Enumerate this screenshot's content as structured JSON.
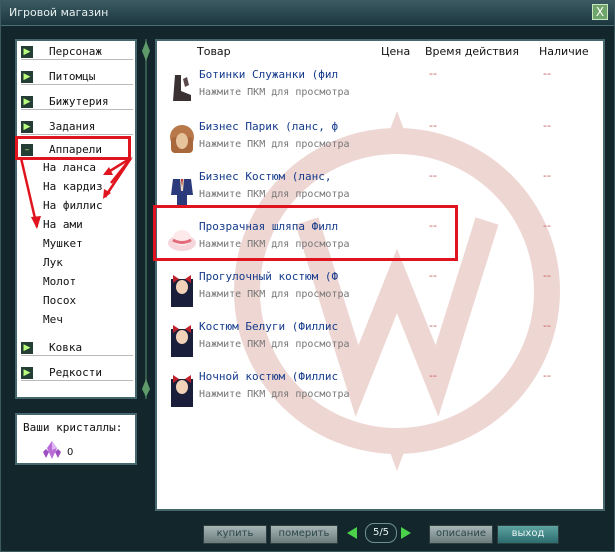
{
  "window": {
    "title": "Игровой магазин",
    "close_glyph": "X"
  },
  "sidebar": {
    "categories": [
      {
        "glyph": "▶",
        "label": "Персонаж"
      },
      {
        "glyph": "▶",
        "label": "Питомцы"
      },
      {
        "glyph": "▶",
        "label": "Бижутерия"
      },
      {
        "glyph": "▶",
        "label": "Задания"
      },
      {
        "glyph": "–",
        "label": "Аппарели"
      }
    ],
    "subitems": [
      "На ланса",
      "На кардиз",
      "На филлис",
      "На ами",
      "Мушкет",
      "Лук",
      "Молот",
      "Посох",
      "Меч"
    ],
    "bottom_categories": [
      {
        "glyph": "▶",
        "label": "Ковка"
      },
      {
        "glyph": "▶",
        "label": "Редкости"
      }
    ]
  },
  "crystals": {
    "label": "Ваши кристаллы:",
    "value": "0"
  },
  "table": {
    "headers": {
      "item": "Товар",
      "price": "Цена",
      "duration": "Время действия",
      "availability": "Наличие"
    },
    "rows": [
      {
        "name": "Ботинки Служанки (фил",
        "hint": "Нажмите ПКМ для просмотра",
        "duration": "--",
        "availability": "--",
        "icon": "boots-icon"
      },
      {
        "name": "Бизнес Парик (ланс, ф",
        "hint": "Нажмите ПКМ для просмотра",
        "duration": "--",
        "availability": "--",
        "icon": "wig-icon"
      },
      {
        "name": "Бизнес Костюм (ланс,",
        "hint": "Нажмите ПКМ для просмотра",
        "duration": "--",
        "availability": "--",
        "icon": "suit-icon"
      },
      {
        "name": "Прозрачная шляпа Филл",
        "hint": "Нажмите ПКМ для просмотра",
        "duration": "--",
        "availability": "--",
        "icon": "hat-icon"
      },
      {
        "name": "Прогулочный костюм (Ф",
        "hint": "Нажмите ПКМ для просмотра",
        "duration": "--",
        "availability": "--",
        "icon": "character-icon"
      },
      {
        "name": "Костюм Белуги (Филлис",
        "hint": "Нажмите ПКМ для просмотра",
        "duration": "--",
        "availability": "--",
        "icon": "character-icon"
      },
      {
        "name": "Ночной костюм (Филлис",
        "hint": "Нажмите ПКМ для просмотра",
        "duration": "--",
        "availability": "--",
        "icon": "character-icon"
      }
    ]
  },
  "footer": {
    "buy": "купить",
    "try": "померить",
    "page": "5/5",
    "describe": "описание",
    "exit": "выход"
  },
  "colors": {
    "annotation": "#e0141e",
    "accent": "#4bd24a"
  }
}
